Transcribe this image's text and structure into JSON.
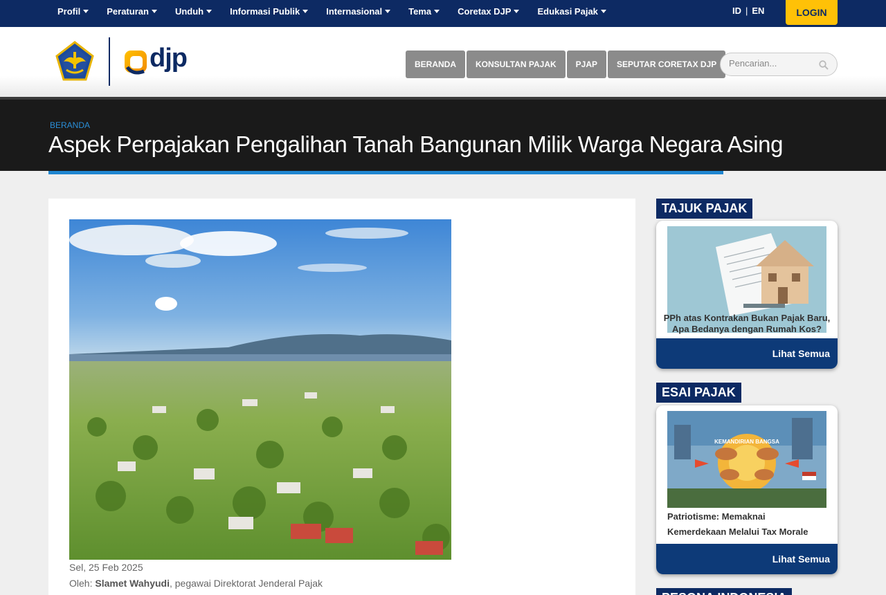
{
  "topnav": {
    "items": [
      {
        "label": "Profil"
      },
      {
        "label": "Peraturan"
      },
      {
        "label": "Unduh"
      },
      {
        "label": "Informasi Publik"
      },
      {
        "label": "Internasional"
      },
      {
        "label": "Tema"
      },
      {
        "label": "Coretax DJP"
      },
      {
        "label": "Edukasi Pajak"
      }
    ],
    "lang_id": "ID",
    "lang_sep": "|",
    "lang_en": "EN",
    "login_label": "LOGIN"
  },
  "header": {
    "logo_text": "djp",
    "nav": [
      {
        "label": "BERANDA"
      },
      {
        "label": "KONSULTAN PAJAK"
      },
      {
        "label": "PJAP"
      },
      {
        "label": "SEPUTAR CORETAX DJP"
      }
    ],
    "search_placeholder": "Pencarian..."
  },
  "title_band": {
    "breadcrumb": "BERANDA",
    "title": "Aspek Perpajakan Pengalihan Tanah Bangunan Milik Warga Negara Asing"
  },
  "article": {
    "date": "Sel, 25 Feb 2025",
    "author_prefix": "Oleh: ",
    "author_name": "Slamet Wahyudi",
    "author_suffix": ", pegawai Direktorat Jenderal Pajak"
  },
  "sidebar": {
    "tajuk": {
      "title": "TAJUK PAJAK",
      "caption": "PPh atas Kontrakan Bukan Pajak Baru, Apa Bedanya dengan Rumah Kos?",
      "footer": "Lihat Semua"
    },
    "esai": {
      "title": "ESAI PAJAK",
      "image_text": "KEMANDIRIAN BANGSA",
      "caption": "Patriotisme: Memaknai Kemerdekaan Melalui Tax Morale",
      "footer": "Lihat Semua"
    },
    "pesona": {
      "title": "PESONA INDONESIA"
    }
  },
  "colors": {
    "navy": "#0d2a63",
    "accent_blue": "#1f86d0",
    "login_yellow": "#ffc107",
    "nav_gray": "#8b8b8b"
  }
}
